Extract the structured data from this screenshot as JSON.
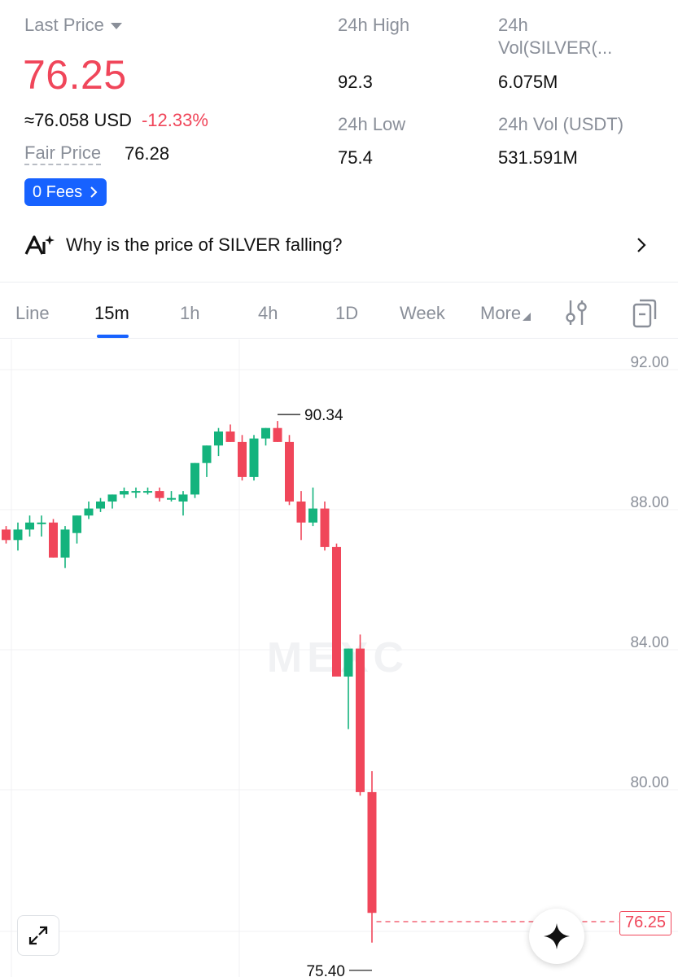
{
  "header": {
    "last_price_label": "Last Price",
    "last_price": "76.25",
    "usd_equivalent": "≈76.058 USD",
    "change_pct": "-12.33%",
    "fair_price_label": "Fair Price",
    "fair_price": "76.28",
    "fees_button": "0 Fees",
    "high_label": "24h High",
    "high_value": "92.3",
    "low_label": "24h Low",
    "low_value": "75.4",
    "vol_base_label_line1": "24h",
    "vol_base_label_line2": "Vol(SILVER(...",
    "vol_base_value": "6.075M",
    "vol_usdt_label": "24h Vol (USDT)",
    "vol_usdt_value": "531.591M"
  },
  "ai_banner": {
    "text": "Why is the price of SILVER falling?",
    "icon": "ai-sparkle-icon"
  },
  "tabs": [
    {
      "label": "Line",
      "active": false
    },
    {
      "label": "15m",
      "active": true
    },
    {
      "label": "1h",
      "active": false
    },
    {
      "label": "4h",
      "active": false
    },
    {
      "label": "1D",
      "active": false
    },
    {
      "label": "Week",
      "active": false
    },
    {
      "label": "More",
      "active": false
    }
  ],
  "colors": {
    "up": "#14b37d",
    "down": "#f0465a",
    "accent": "#1762ff",
    "muted": "#8a8f99"
  },
  "chart_data": {
    "type": "candlestick",
    "watermark": "MEXC",
    "y_axis_ticks": [
      "92.00",
      "88.00",
      "84.00",
      "80.00"
    ],
    "ylim": [
      75.0,
      93.0
    ],
    "high_marker": "90.34",
    "low_marker": "75.40",
    "current_price_tag": "76.25",
    "current_price": 76.25,
    "candles": [
      {
        "o": 87.2,
        "h": 87.3,
        "l": 86.8,
        "c": 86.9
      },
      {
        "o": 86.9,
        "h": 87.4,
        "l": 86.6,
        "c": 87.2
      },
      {
        "o": 87.2,
        "h": 87.6,
        "l": 87.0,
        "c": 87.4
      },
      {
        "o": 87.4,
        "h": 87.6,
        "l": 87.0,
        "c": 87.4
      },
      {
        "o": 87.4,
        "h": 87.5,
        "l": 86.4,
        "c": 86.4
      },
      {
        "o": 86.4,
        "h": 87.3,
        "l": 86.1,
        "c": 87.2
      },
      {
        "o": 87.1,
        "h": 87.6,
        "l": 86.8,
        "c": 87.6
      },
      {
        "o": 87.6,
        "h": 88.0,
        "l": 87.5,
        "c": 87.8
      },
      {
        "o": 87.8,
        "h": 88.1,
        "l": 87.7,
        "c": 88.0
      },
      {
        "o": 88.0,
        "h": 88.2,
        "l": 87.8,
        "c": 88.2
      },
      {
        "o": 88.2,
        "h": 88.4,
        "l": 88.1,
        "c": 88.3
      },
      {
        "o": 88.3,
        "h": 88.4,
        "l": 88.1,
        "c": 88.3
      },
      {
        "o": 88.3,
        "h": 88.4,
        "l": 88.2,
        "c": 88.3
      },
      {
        "o": 88.3,
        "h": 88.4,
        "l": 88.0,
        "c": 88.1
      },
      {
        "o": 88.1,
        "h": 88.3,
        "l": 88.0,
        "c": 88.1
      },
      {
        "o": 88.0,
        "h": 88.3,
        "l": 87.6,
        "c": 88.2
      },
      {
        "o": 88.2,
        "h": 89.1,
        "l": 88.1,
        "c": 89.1
      },
      {
        "o": 89.1,
        "h": 89.6,
        "l": 88.7,
        "c": 89.6
      },
      {
        "o": 89.6,
        "h": 90.1,
        "l": 89.3,
        "c": 90.0
      },
      {
        "o": 90.0,
        "h": 90.2,
        "l": 89.7,
        "c": 89.7
      },
      {
        "o": 89.7,
        "h": 89.9,
        "l": 88.6,
        "c": 88.7
      },
      {
        "o": 88.7,
        "h": 89.9,
        "l": 88.6,
        "c": 89.8
      },
      {
        "o": 89.8,
        "h": 90.1,
        "l": 89.6,
        "c": 90.1
      },
      {
        "o": 90.1,
        "h": 90.3,
        "l": 89.7,
        "c": 89.7
      },
      {
        "o": 89.7,
        "h": 89.9,
        "l": 87.9,
        "c": 88.0
      },
      {
        "o": 88.0,
        "h": 88.3,
        "l": 86.9,
        "c": 87.4
      },
      {
        "o": 87.4,
        "h": 88.4,
        "l": 87.3,
        "c": 87.8
      },
      {
        "o": 87.8,
        "h": 88.0,
        "l": 86.6,
        "c": 86.7
      },
      {
        "o": 86.7,
        "h": 86.8,
        "l": 83.0,
        "c": 83.0
      },
      {
        "o": 83.0,
        "h": 83.8,
        "l": 81.5,
        "c": 83.8
      },
      {
        "o": 83.8,
        "h": 84.2,
        "l": 79.6,
        "c": 79.7
      },
      {
        "o": 79.7,
        "h": 80.3,
        "l": 75.4,
        "c": 76.25
      }
    ]
  }
}
